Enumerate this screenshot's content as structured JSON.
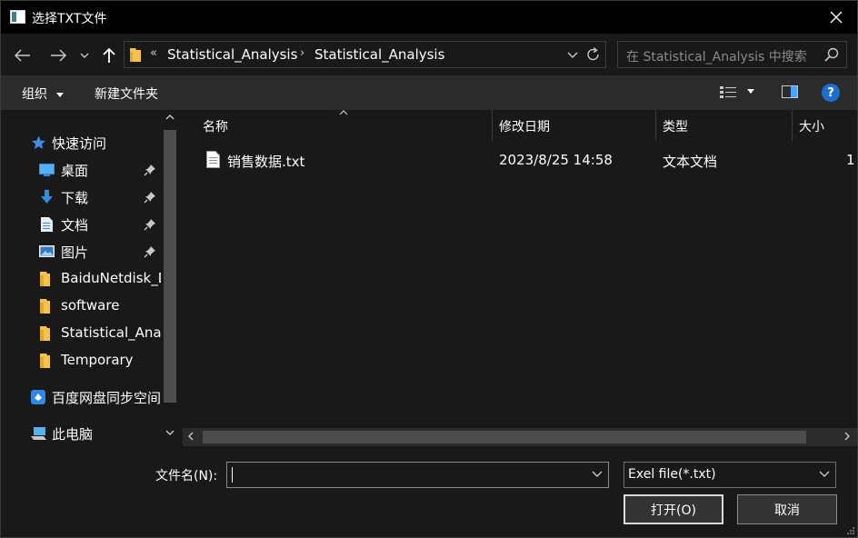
{
  "window": {
    "title": "选择TXT文件"
  },
  "address_bar": {
    "overflow_symbol": "«",
    "crumbs": [
      "Statistical_Analysis",
      "Statistical_Analysis"
    ],
    "crumb_separator": "›"
  },
  "search": {
    "placeholder": "在 Statistical_Analysis 中搜索"
  },
  "toolbar": {
    "organize_label": "组织",
    "new_folder_label": "新建文件夹",
    "help_label": "?"
  },
  "nav": {
    "items": [
      {
        "label": "快速访问",
        "icon": "star-icon"
      },
      {
        "label": "桌面",
        "icon": "desktop-icon",
        "pinned": true
      },
      {
        "label": "下载",
        "icon": "download-icon",
        "pinned": true
      },
      {
        "label": "文档",
        "icon": "document-icon",
        "pinned": true
      },
      {
        "label": "图片",
        "icon": "pictures-icon",
        "pinned": true
      },
      {
        "label": "BaiduNetdisk_D",
        "icon": "folder-icon"
      },
      {
        "label": "software",
        "icon": "folder-icon"
      },
      {
        "label": "Statistical_Anal",
        "icon": "folder-icon"
      },
      {
        "label": "Temporary",
        "icon": "folder-icon"
      },
      {
        "label": "百度网盘同步空间",
        "icon": "cloud-sync-icon"
      },
      {
        "label": "此电脑",
        "icon": "computer-icon"
      }
    ]
  },
  "file_list": {
    "columns": [
      "名称",
      "修改日期",
      "类型",
      "大小"
    ],
    "rows": [
      {
        "name": "销售数据.txt",
        "modified": "2023/8/25 14:58",
        "type": "文本文档",
        "size": "1"
      }
    ]
  },
  "bottom": {
    "filename_label": "文件名(N):",
    "filename_value": "",
    "filter_value": "Exel file(*.txt)",
    "open_label": "打开(O)",
    "cancel_label": "取消"
  },
  "colors": {
    "background": "#191919",
    "titlebar": "#000000",
    "toolbar": "#2b2b2b",
    "accent": "#1f6fd1",
    "folder": "#f3c24f"
  }
}
